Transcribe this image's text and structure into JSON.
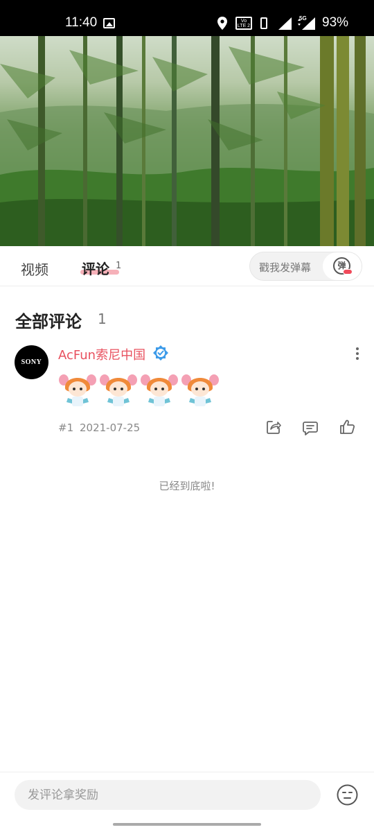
{
  "status_bar": {
    "time": "11:40",
    "volte_label": "Vo LTE 2",
    "network_label": "5G",
    "battery": "93%"
  },
  "tabs": {
    "video_label": "视频",
    "comments_label": "评论",
    "comments_count": "1",
    "danmaku_placeholder": "戳我发弹幕",
    "danmaku_toggle_label": "弹"
  },
  "comments_section": {
    "title": "全部评论",
    "count": "1",
    "items": [
      {
        "avatar_text": "SONY",
        "username": "AcFun索尼中国",
        "verified": true,
        "sticker_count": 4,
        "floor": "#1",
        "date": "2021-07-25"
      }
    ],
    "end_text": "已经到底啦!"
  },
  "bottom_bar": {
    "comment_placeholder": "发评论拿奖励"
  },
  "colors": {
    "accent": "#e8505e",
    "verified": "#3d9be9",
    "tab_underline": "#f5a3ad"
  }
}
